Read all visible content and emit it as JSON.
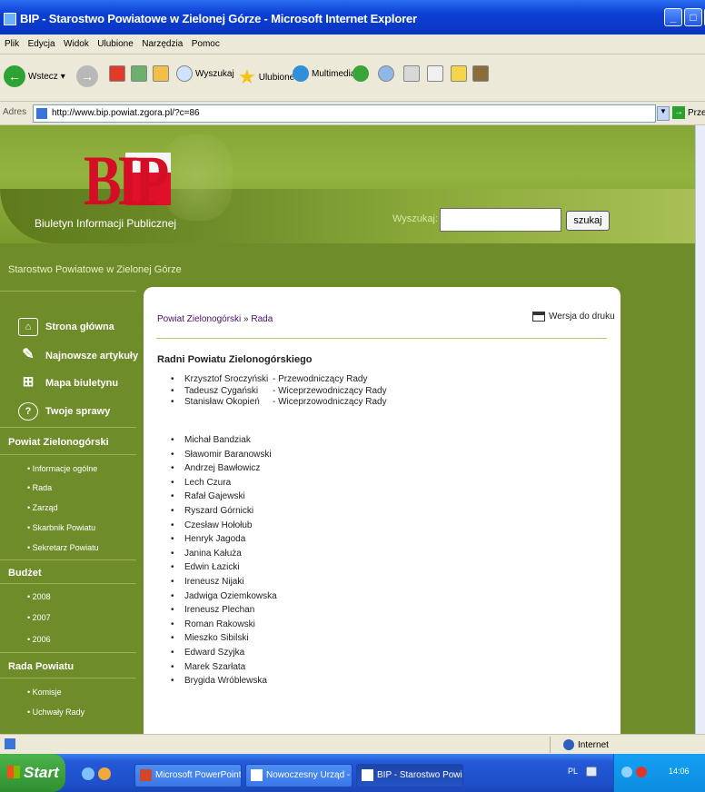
{
  "window": {
    "title": "BIP - Starostwo Powiatowe w Zielonej Górze - Microsoft Internet Explorer",
    "menu": [
      "Plik",
      "Edycja",
      "Widok",
      "Ulubione",
      "Narzędzia",
      "Pomoc"
    ]
  },
  "toolbar": {
    "back_label": "Wstecz",
    "search_label": "Wyszukaj",
    "favorites_label": "Ulubione",
    "multimedia_label": "Multimedia"
  },
  "address": {
    "label": "Adres",
    "url": "http://www.bip.powiat.zgora.pl/?c=86",
    "go_label": "Przejdź"
  },
  "header": {
    "logo_text": "BIP",
    "subtitle": "Biuletyn Informacji Publicznej",
    "search_label": "Wyszukaj:",
    "search_value": "",
    "search_button": "szukaj"
  },
  "site_name": "Starostwo Powiatowe w Zielonej Górze",
  "sidebar": {
    "main_links": [
      {
        "label": "Strona główna",
        "icon": "home-icon"
      },
      {
        "label": "Najnowsze artykuły",
        "icon": "pencil-icon"
      },
      {
        "label": "Mapa biuletynu",
        "icon": "sitemap-icon"
      },
      {
        "label": "Twoje sprawy",
        "icon": "question-icon"
      }
    ],
    "sections": [
      {
        "title": "Powiat Zielonogórski",
        "items": [
          "Informacje ogólne",
          "Rada",
          "Zarząd",
          "Skarbnik Powiatu",
          "Sekretarz Powiatu"
        ]
      },
      {
        "title": "Budżet",
        "items": [
          "2008",
          "2007",
          "2006"
        ]
      },
      {
        "title": "Rada Powiatu",
        "items": [
          "Komisje",
          "Uchwały Rady"
        ]
      }
    ]
  },
  "content": {
    "breadcrumb_parent": "Powiat Zielonogórski",
    "breadcrumb_sep": " » ",
    "breadcrumb_current": "Rada",
    "print_label": "Wersja do druku",
    "heading": "Radni Powiatu Zielonogórskiego",
    "officers": [
      {
        "name": "Krzysztof Sroczyński",
        "role": "- Przewodniczący Rady"
      },
      {
        "name": "Tadeusz Cygański",
        "role": "- Wiceprzewodniczący Rady"
      },
      {
        "name": "Stanisław Okopień",
        "role": "- Wiceprzowodniczący Rady"
      }
    ],
    "members": [
      "Michał Bandziak",
      "Sławomir Baranowski",
      "Andrzej Bawłowicz",
      "Lech Czura",
      "Rafał Gajewski",
      "Ryszard Górnicki",
      "Czesław Hołołub",
      "Henryk Jagoda",
      "Janina Kałuża",
      "Edwin Łazicki",
      "Ireneusz Nijaki",
      "Jadwiga Oziemkowska",
      "Ireneusz Plechan",
      "Roman Rakowski",
      "Mieszko Sibilski",
      "Edward Szyjka",
      "Marek Szarłata",
      "Brygida Wróblewska"
    ]
  },
  "statusbar": {
    "zone": "Internet"
  },
  "taskbar": {
    "start_label": "Start",
    "tasks": [
      "Microsoft PowerPoint ...",
      "Nowoczesny Urząd - ...",
      "BIP - Starostwo Powi..."
    ],
    "language": "PL",
    "clock": "14:06"
  }
}
